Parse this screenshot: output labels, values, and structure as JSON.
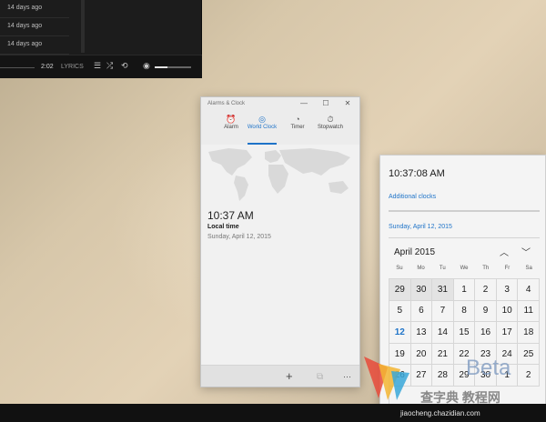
{
  "music_player": {
    "rows": [
      "14 days ago",
      "14 days ago",
      "14 days ago"
    ],
    "time_elapsed": "2:02",
    "lyrics_label": "LYRICS",
    "icons": [
      "list-icon",
      "shuffle-icon",
      "repeat-icon",
      "volume-icon"
    ]
  },
  "clock_window": {
    "title": "Alarms & Clock",
    "tabs": [
      {
        "label": "Alarm",
        "icon": "alarm-clock-icon"
      },
      {
        "label": "World Clock",
        "icon": "globe-icon",
        "active": true
      },
      {
        "label": "Timer",
        "icon": "timer-icon"
      },
      {
        "label": "Stopwatch",
        "icon": "stopwatch-icon"
      }
    ],
    "time": "10:37 AM",
    "location": "Local time",
    "date": "Sunday, April 12, 2015",
    "bottom_icons": [
      "add-icon",
      "compare-icon",
      "more-icon"
    ],
    "accent": "#1e73c8"
  },
  "flyout": {
    "time": "10:37:08 AM",
    "additional_clocks": "Additional clocks",
    "date": "Sunday, April 12, 2015",
    "month": "April 2015",
    "weekdays": [
      "Su",
      "Mo",
      "Tu",
      "We",
      "Th",
      "Fr",
      "Sa"
    ],
    "days": [
      "29",
      "30",
      "31",
      "1",
      "2",
      "3",
      "4",
      "5",
      "6",
      "7",
      "8",
      "9",
      "10",
      "11",
      "12",
      "13",
      "14",
      "15",
      "16",
      "17",
      "18",
      "19",
      "20",
      "21",
      "22",
      "23",
      "24",
      "25",
      "26",
      "27",
      "28",
      "29",
      "30",
      "1",
      "2"
    ],
    "today": "12"
  },
  "watermark": {
    "brand": "Beta",
    "cn_text": "查字典 教程网",
    "url": "jiaocheng.chazidian.com"
  }
}
